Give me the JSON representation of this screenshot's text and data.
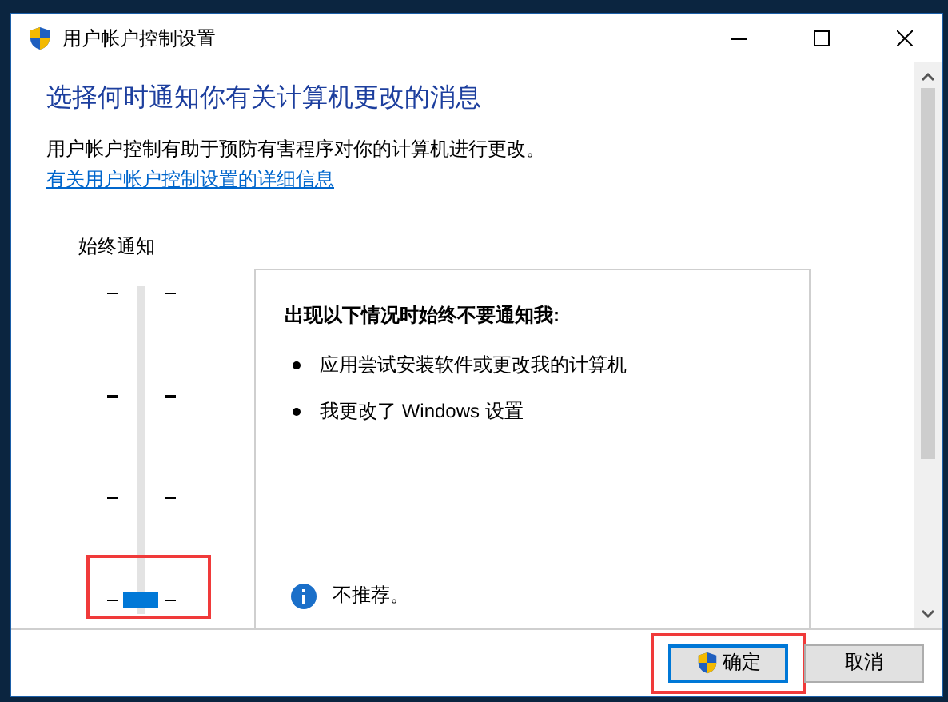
{
  "window": {
    "title": "用户帐户控制设置"
  },
  "heading": "选择何时通知你有关计算机更改的消息",
  "description": "用户帐户控制有助于预防有害程序对你的计算机进行更改。",
  "link": "有关用户帐户控制设置的详细信息",
  "slider": {
    "top_label": "始终通知",
    "level": 0,
    "highlighted": true
  },
  "panel": {
    "title": "出现以下情况时始终不要通知我:",
    "bullets": [
      "应用尝试安装软件或更改我的计算机",
      "我更改了 Windows 设置"
    ],
    "note": "不推荐。"
  },
  "buttons": [
    {
      "label": "确定",
      "kind": "shield",
      "default": true,
      "highlighted": true
    },
    {
      "label": "取消",
      "kind": "plain",
      "default": false,
      "highlighted": false
    }
  ]
}
